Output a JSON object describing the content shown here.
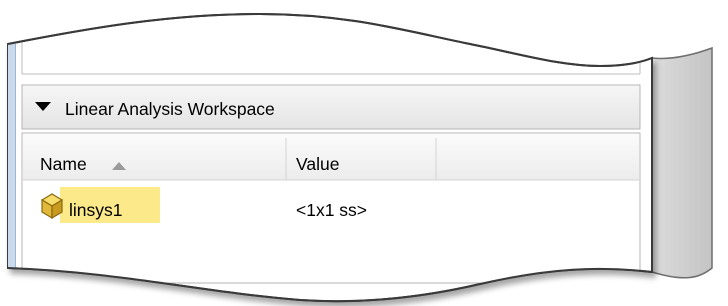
{
  "panel": {
    "title": "Linear Analysis Workspace",
    "expanded": true
  },
  "table": {
    "columns": [
      {
        "label": "Name",
        "sort": "ascending"
      },
      {
        "label": "Value"
      },
      {
        "label": ""
      }
    ],
    "rows": [
      {
        "name": "linsys1",
        "value": "<1x1 ss>",
        "icon": "cube-icon",
        "selected": true
      }
    ]
  },
  "colors": {
    "selection_highlight": "#fbe98a",
    "header_background": "#eeeeee",
    "border": "#a9a9a9",
    "window_edge": "#cbd9ec",
    "icon_fill": "#e8c54a"
  }
}
